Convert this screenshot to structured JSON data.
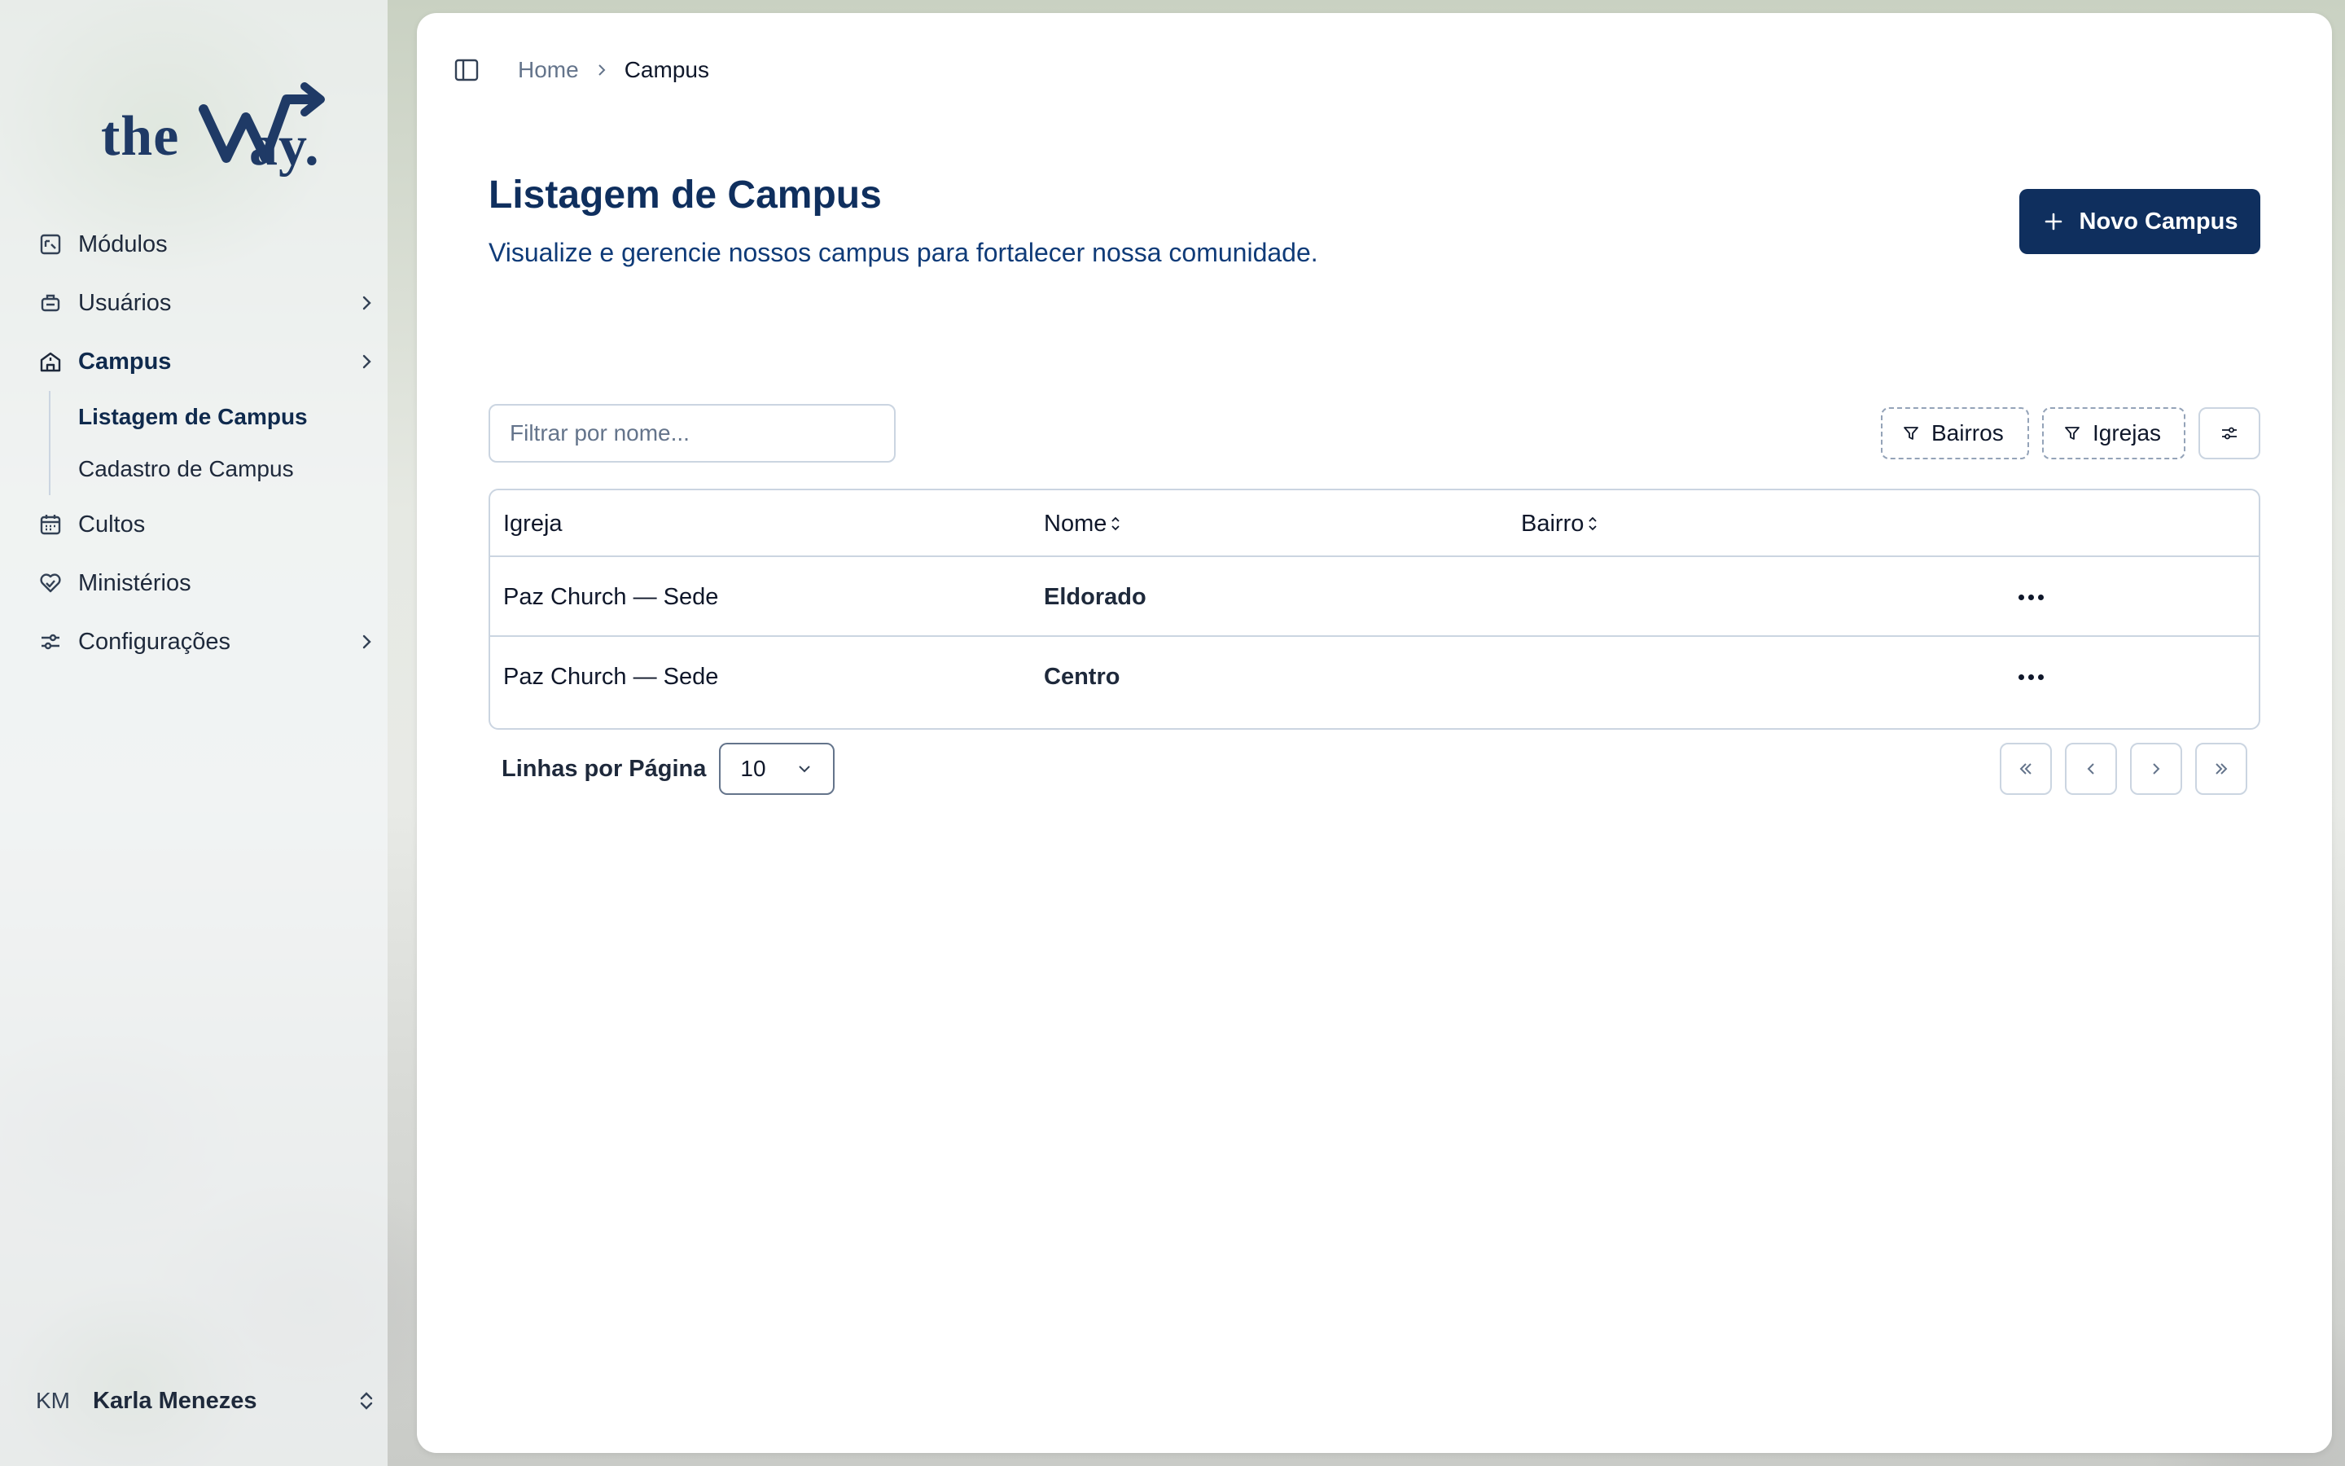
{
  "brand": {
    "logo_text": "theWay."
  },
  "sidebar": {
    "items": [
      {
        "label": "Módulos",
        "icon": "modules-icon"
      },
      {
        "label": "Usuários",
        "icon": "users-icon"
      },
      {
        "label": "Campus",
        "icon": "campus-icon"
      },
      {
        "label": "Cultos",
        "icon": "calendar-icon"
      },
      {
        "label": "Ministérios",
        "icon": "ministries-icon"
      },
      {
        "label": "Configurações",
        "icon": "settings-icon"
      }
    ],
    "sub_items": [
      {
        "label": "Listagem de Campus"
      },
      {
        "label": "Cadastro de Campus"
      }
    ],
    "active_item": "Campus",
    "active_sub_item": "Listagem de Campus"
  },
  "user": {
    "initials": "KM",
    "name": "Karla Menezes"
  },
  "breadcrumb": {
    "home": "Home",
    "current": "Campus"
  },
  "page": {
    "title": "Listagem de Campus",
    "subtitle": "Visualize e gerencie nossos campus para fortalecer nossa comunidade.",
    "new_button": "Novo Campus"
  },
  "filters": {
    "search_placeholder": "Filtrar por nome...",
    "bairros": "Bairros",
    "igrejas": "Igrejas"
  },
  "table": {
    "columns": [
      "Igreja",
      "Nome",
      "Bairro"
    ],
    "rows": [
      {
        "igreja": "Paz Church — Sede",
        "nome": "Eldorado",
        "bairro": ""
      },
      {
        "igreja": "Paz Church — Sede",
        "nome": "Centro",
        "bairro": ""
      }
    ]
  },
  "pagination": {
    "rows_label": "Linhas por Página",
    "rows_per_page": "10"
  },
  "colors": {
    "primary": "#0f2f5e",
    "subtitle": "#0f3b78",
    "border": "#cbd5e1"
  }
}
